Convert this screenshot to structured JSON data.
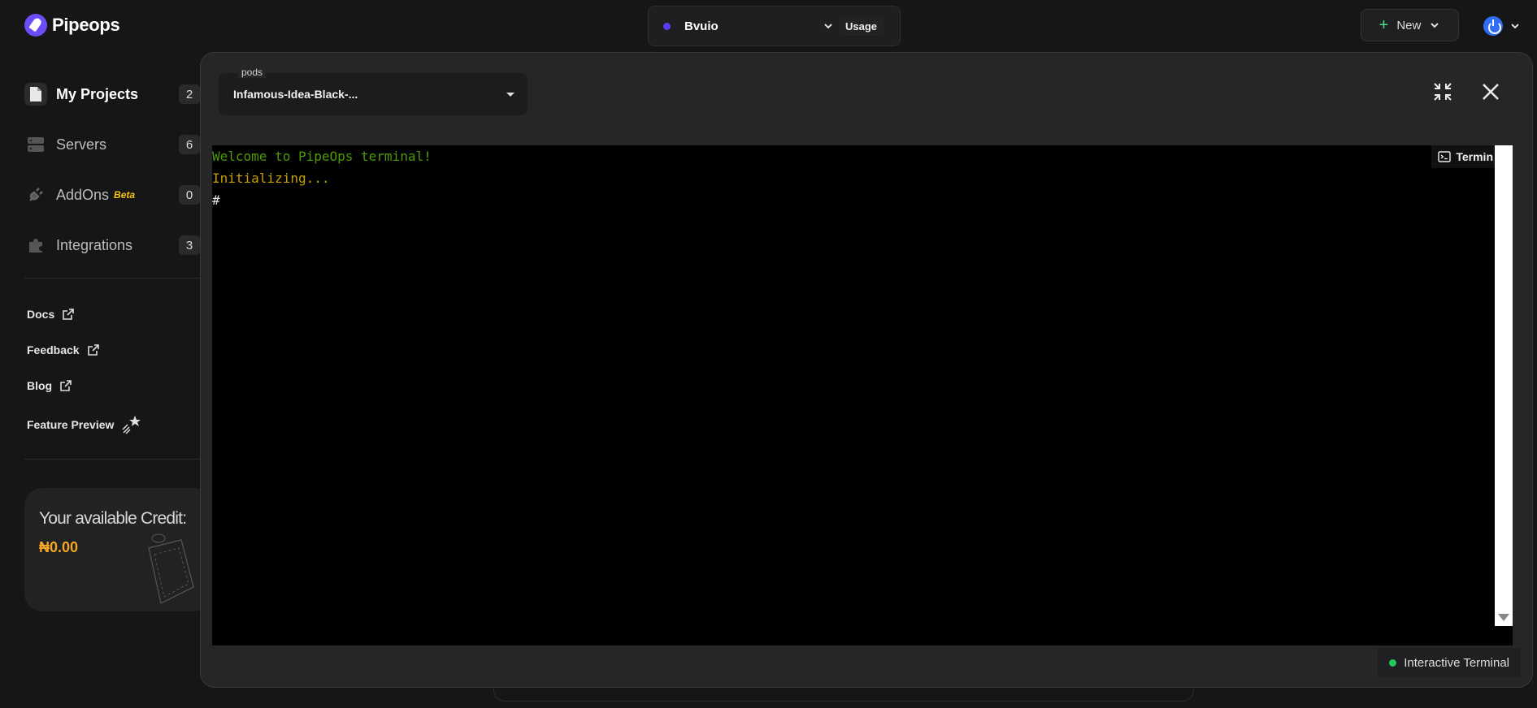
{
  "app": {
    "name": "Pipeops"
  },
  "header": {
    "workspace": {
      "name": "Bvuio",
      "dot_color": "#5b3cf5"
    },
    "usage_label": "Usage",
    "new_label": "New"
  },
  "sidebar": {
    "items": [
      {
        "label": "My Projects",
        "count": "2",
        "icon": "file-icon",
        "active": true
      },
      {
        "label": "Servers",
        "count": "6",
        "icon": "server-icon"
      },
      {
        "label": "AddOns",
        "badge": "Beta",
        "count": "0",
        "icon": "plug-icon"
      },
      {
        "label": "Integrations",
        "count": "3",
        "icon": "puzzle-icon"
      }
    ],
    "links": [
      {
        "label": "Docs",
        "icon": "external-link-icon"
      },
      {
        "label": "Feedback",
        "icon": "external-link-icon"
      },
      {
        "label": "Blog",
        "icon": "external-link-icon"
      },
      {
        "label": "Feature Preview",
        "icon": "shooting-star-icon"
      }
    ],
    "credit": {
      "title": "Your available Credit:",
      "value": "₦0.00"
    }
  },
  "modal": {
    "pods": {
      "label": "pods",
      "value": "Infamous-Idea-Black-..."
    },
    "terminal": {
      "lines": [
        {
          "text": "Welcome to PipeOps terminal!",
          "color": "#4e9a06"
        },
        {
          "text": "Initializing...",
          "color": "#c4a000"
        },
        {
          "text": "#",
          "color": "#e6e6e6"
        }
      ],
      "tab_label": "Termin",
      "status_label": "Interactive Terminal",
      "status_color": "#22c55e"
    }
  }
}
